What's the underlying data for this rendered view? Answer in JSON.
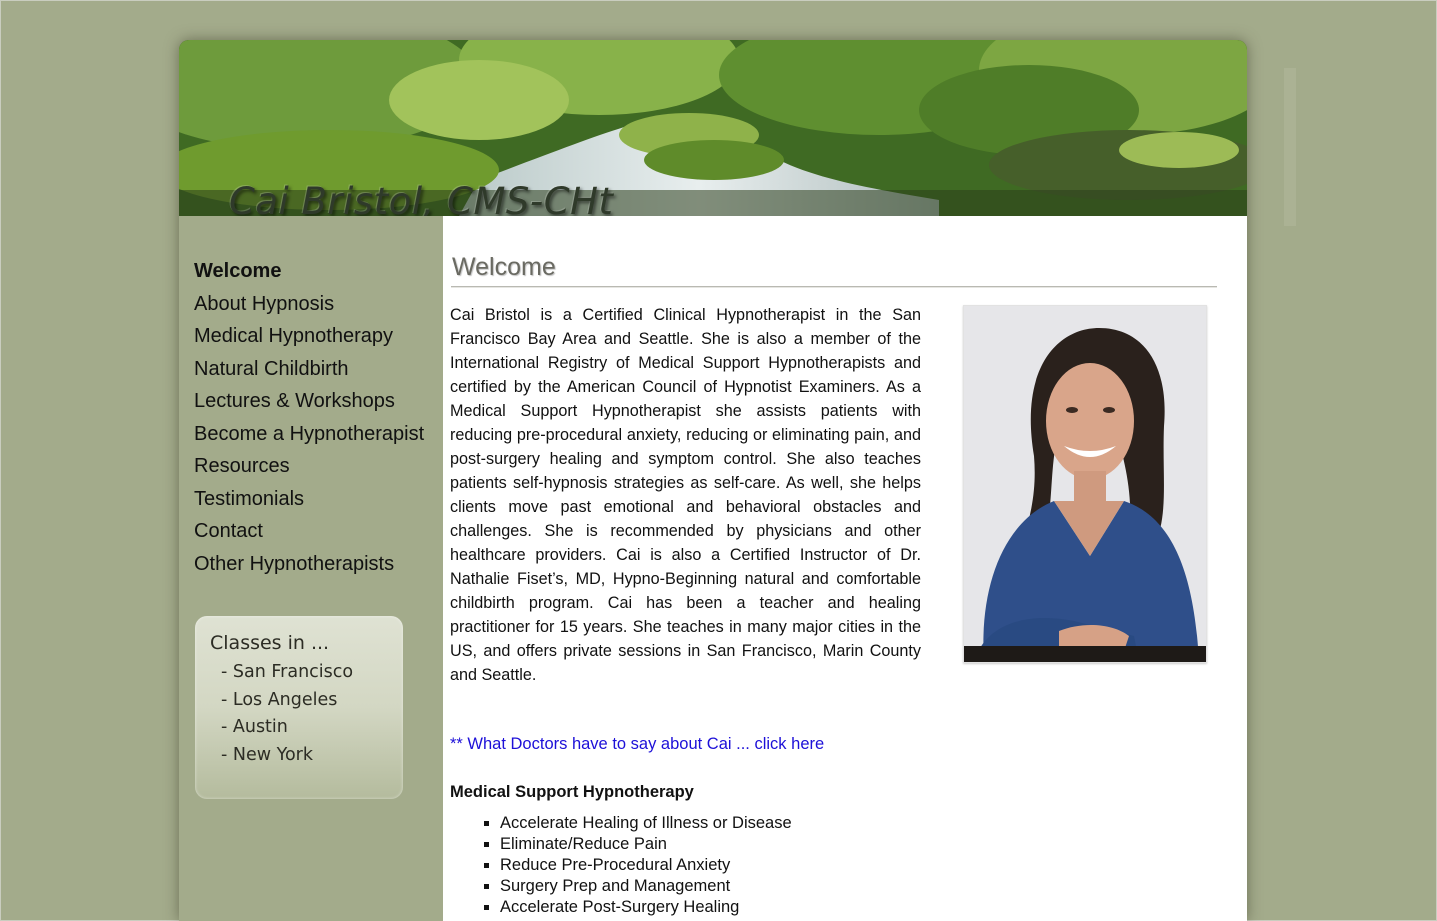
{
  "header": {
    "site_title": "Cai Bristol, CMS-CHt"
  },
  "sidebar": {
    "nav_items": [
      {
        "label": "Welcome",
        "active": true
      },
      {
        "label": "About Hypnosis",
        "active": false
      },
      {
        "label": "Medical Hypnotherapy",
        "active": false
      },
      {
        "label": "Natural Childbirth",
        "active": false
      },
      {
        "label": "Lectures & Workshops",
        "active": false
      },
      {
        "label": "Become a Hypnotherapist",
        "active": false
      },
      {
        "label": "Resources",
        "active": false
      },
      {
        "label": "Testimonials",
        "active": false
      },
      {
        "label": "Contact",
        "active": false
      },
      {
        "label": "Other Hypnotherapists",
        "active": false
      }
    ],
    "classes": {
      "title": "Classes in ...",
      "cities": [
        "- San Francisco",
        "- Los Angeles",
        "- Austin",
        "- New York"
      ]
    }
  },
  "main": {
    "page_title": "Welcome",
    "intro": "Cai Bristol is a Certified Clinical Hypnotherapist in the San Francisco Bay Area and Seattle. She is also a member of the International Registry of Medical Support Hypnotherapists and certified by the American Council of Hypnotist Examiners. As a Medical Support Hypnotherapist she assists patients with reducing pre-procedural anxiety, reducing or eliminating pain, and post-surgery healing and symptom control. She also teaches patients self-hypnosis strategies as self-care. As well, she helps clients move past emotional and behavioral obstacles and challenges. She is recommended by physicians and other healthcare providers. Cai is also a Certified Instructor of Dr. Nathalie Fiset’s, MD, Hypno-Beginning natural and comfortable childbirth program. Cai has been a teacher and healing practitioner for 15 years. She teaches in many major cities in the US, and offers private sessions in San Francisco, Marin County and Seattle.",
    "doctors_link": "** What Doctors have to say about Cai ... click here",
    "section_heading": "Medical Support Hypnotherapy",
    "benefits": [
      "Accelerate Healing of Illness or Disease",
      "Eliminate/Reduce Pain",
      "Reduce Pre-Procedural Anxiety",
      "Surgery Prep and Management",
      "Accelerate Post-Surgery Healing"
    ]
  },
  "colors": {
    "page_background": "#a3ab8b",
    "link": "#1d10d8",
    "content_background": "#ffffff"
  }
}
